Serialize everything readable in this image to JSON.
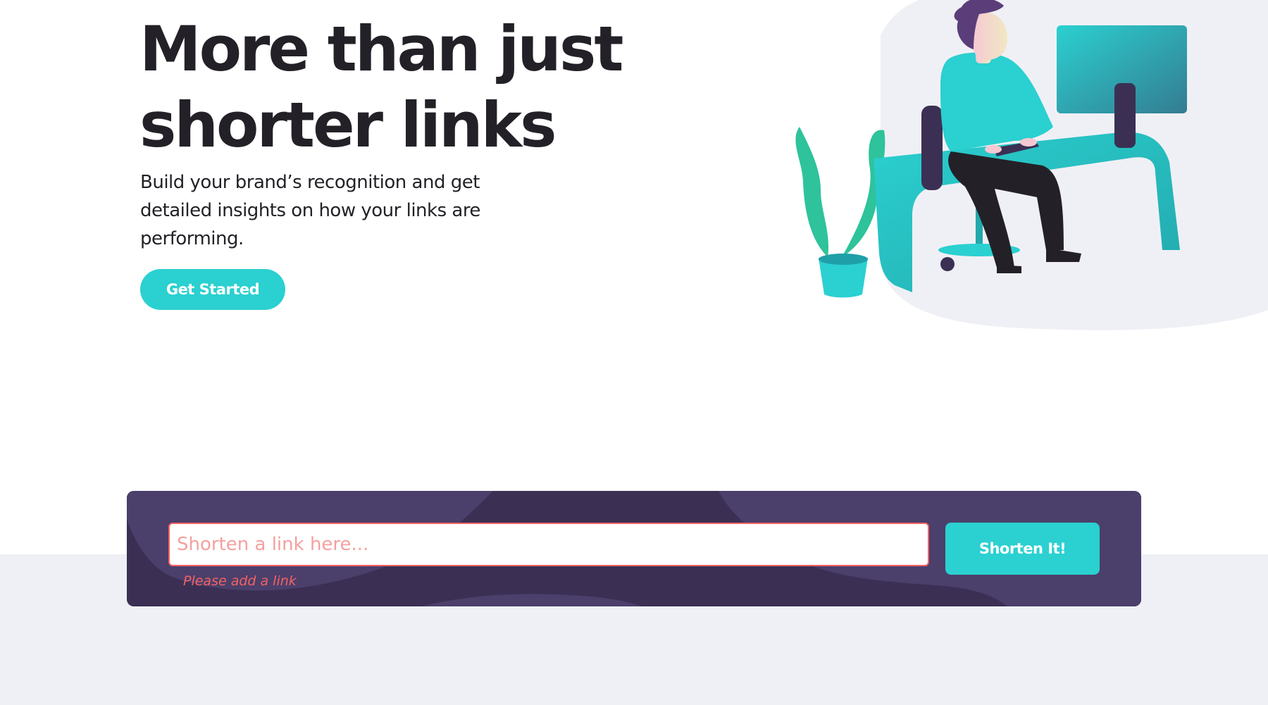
{
  "hero": {
    "title_line1": "More than just",
    "title_line2": "shorter links",
    "subtitle": "Build your brand’s recognition and get detailed insights on how your links are performing.",
    "cta_label": "Get Started",
    "illustration": "illustration-working"
  },
  "shorten": {
    "placeholder": "Shorten a link here...",
    "value": "",
    "error": "Please add a link",
    "button_label": "Shorten It!"
  },
  "colors": {
    "primary_cyan": "#2bd0d0",
    "dark_violet": "#3b3054",
    "error_red": "#f46262",
    "heading_dark": "#232127",
    "band_gray": "#eff0f5"
  }
}
